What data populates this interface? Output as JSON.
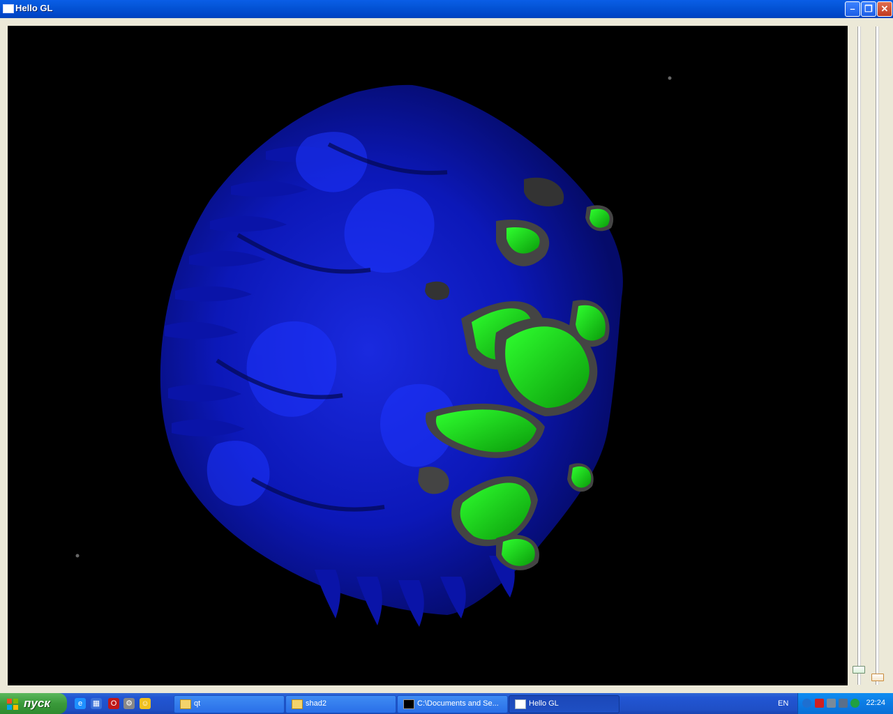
{
  "window": {
    "title": "Hello GL"
  },
  "window_controls": {
    "minimize": "–",
    "restore": "❐",
    "close": "✕"
  },
  "taskbar": {
    "start_label": "пуск",
    "tasks": [
      {
        "label": "qt"
      },
      {
        "label": "shad2"
      },
      {
        "label": "C:\\Documents and Se..."
      },
      {
        "label": "Hello GL"
      }
    ],
    "language": "EN",
    "clock": "22:24"
  }
}
